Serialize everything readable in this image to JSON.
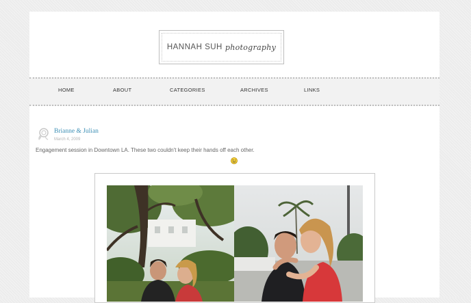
{
  "logo": {
    "name": "HANNAH SUH",
    "script": "photography"
  },
  "nav": {
    "items": [
      {
        "label": "HOME"
      },
      {
        "label": "ABOUT"
      },
      {
        "label": "CATEGORIES"
      },
      {
        "label": "ARCHIVES"
      },
      {
        "label": "LINKS"
      }
    ]
  },
  "post": {
    "icon": "rose-icon",
    "title": "Brianne & Julian",
    "date": "March 4, 2009",
    "body": "Engagement session in Downtown LA. These two couldn't keep their hands off each other.",
    "emoticon": "wink-smiley-icon"
  },
  "photos": {
    "left": "couple-trees-photo",
    "right": "couple-kiss-photo"
  },
  "colors": {
    "background": "#ececec",
    "page": "#ffffff",
    "nav_bg": "#f2f2f2",
    "title_link": "#3c8fb5",
    "date": "#b5b5b5"
  }
}
